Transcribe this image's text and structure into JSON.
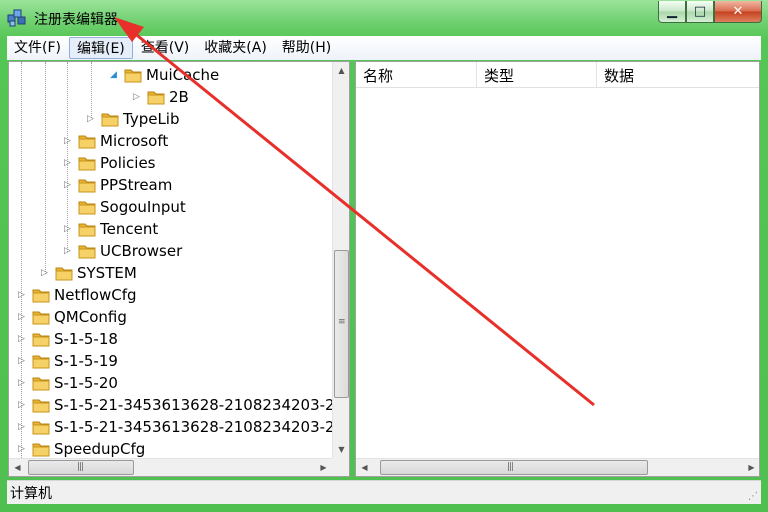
{
  "window": {
    "title": "注册表编辑器",
    "minimize": "▁",
    "maximize": "□",
    "close": "✕"
  },
  "menu": [
    {
      "label": "文件(F)"
    },
    {
      "label": "编辑(E)"
    },
    {
      "label": "查看(V)"
    },
    {
      "label": "收藏夹(A)"
    },
    {
      "label": "帮助(H)"
    }
  ],
  "tree": [
    {
      "label": "MuiCache",
      "expander": "◢"
    },
    {
      "label": "2B",
      "expander": "▷"
    },
    {
      "label": "TypeLib",
      "expander": "▷"
    },
    {
      "label": "Microsoft",
      "expander": "▷"
    },
    {
      "label": "Policies",
      "expander": "▷"
    },
    {
      "label": "PPStream",
      "expander": "▷"
    },
    {
      "label": "SogouInput",
      "expander": ""
    },
    {
      "label": "Tencent",
      "expander": "▷"
    },
    {
      "label": "UCBrowser",
      "expander": "▷"
    },
    {
      "label": "SYSTEM",
      "expander": "▷"
    },
    {
      "label": "NetflowCfg",
      "expander": "▷"
    },
    {
      "label": "QMConfig",
      "expander": "▷"
    },
    {
      "label": "S-1-5-18",
      "expander": "▷"
    },
    {
      "label": "S-1-5-19",
      "expander": "▷"
    },
    {
      "label": "S-1-5-20",
      "expander": "▷"
    },
    {
      "label": "S-1-5-21-3453613628-2108234203-2",
      "expander": "▷"
    },
    {
      "label": "S-1-5-21-3453613628-2108234203-2",
      "expander": "▷"
    },
    {
      "label": "SpeedupCfg",
      "expander": "▷"
    }
  ],
  "list": {
    "columns": [
      "名称",
      "类型",
      "数据"
    ]
  },
  "status": {
    "path": "计算机"
  },
  "icons": {
    "app": "registry-editor-icon",
    "folder": "folder-icon"
  },
  "colors": {
    "frame": "#55c655",
    "annotation_arrow": "#e8302a",
    "folder": "#f3c54a"
  }
}
